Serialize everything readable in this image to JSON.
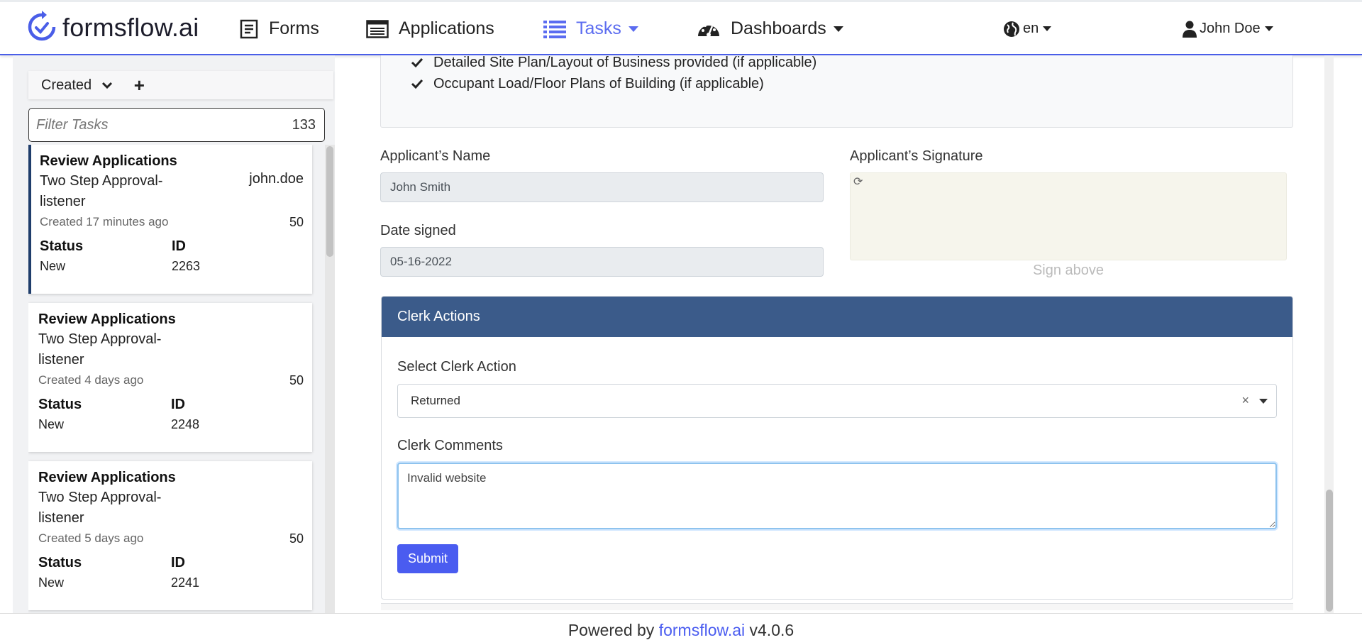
{
  "brand": {
    "name": "formsflow.ai"
  },
  "nav": {
    "forms": "Forms",
    "applications": "Applications",
    "tasks": "Tasks",
    "dashboards": "Dashboards",
    "language": "en",
    "user": "John Doe"
  },
  "sidebar": {
    "sort_label": "Created",
    "filter": {
      "placeholder": "Filter Tasks",
      "count": "133"
    },
    "tasks": [
      {
        "title": "Review Applications",
        "process": "Two Step Approval-listener",
        "assignee": "john.doe",
        "created": "Created 17 minutes ago",
        "priority": "50",
        "status_label": "Status",
        "status": "New",
        "id_label": "ID",
        "id": "2263",
        "selected": true
      },
      {
        "title": "Review Applications",
        "process": "Two Step Approval-listener",
        "assignee": "",
        "created": "Created 4 days ago",
        "priority": "50",
        "status_label": "Status",
        "status": "New",
        "id_label": "ID",
        "id": "2248",
        "selected": false
      },
      {
        "title": "Review Applications",
        "process": "Two Step Approval-listener",
        "assignee": "",
        "created": "Created 5 days ago",
        "priority": "50",
        "status_label": "Status",
        "status": "New",
        "id_label": "ID",
        "id": "2241",
        "selected": false
      }
    ]
  },
  "form": {
    "documents": [
      "Detailed Site Plan/Layout of Business provided (if applicable)",
      "Occupant Load/Floor Plans of Building (if applicable)"
    ],
    "applicant_name_label": "Applicant’s Name",
    "applicant_name_value": "John Smith",
    "date_signed_label": "Date signed",
    "date_signed_value": "05-16-2022",
    "signature_label": "Applicant’s Signature",
    "signature_caption": "Sign above",
    "clerk": {
      "header": "Clerk Actions",
      "action_label": "Select Clerk Action",
      "action_value": "Returned",
      "comments_label": "Clerk Comments",
      "comments_value": "Invalid website",
      "submit": "Submit"
    }
  },
  "footer": {
    "prefix": "Powered by ",
    "link": "formsflow.ai",
    "version": " v4.0.6"
  }
}
